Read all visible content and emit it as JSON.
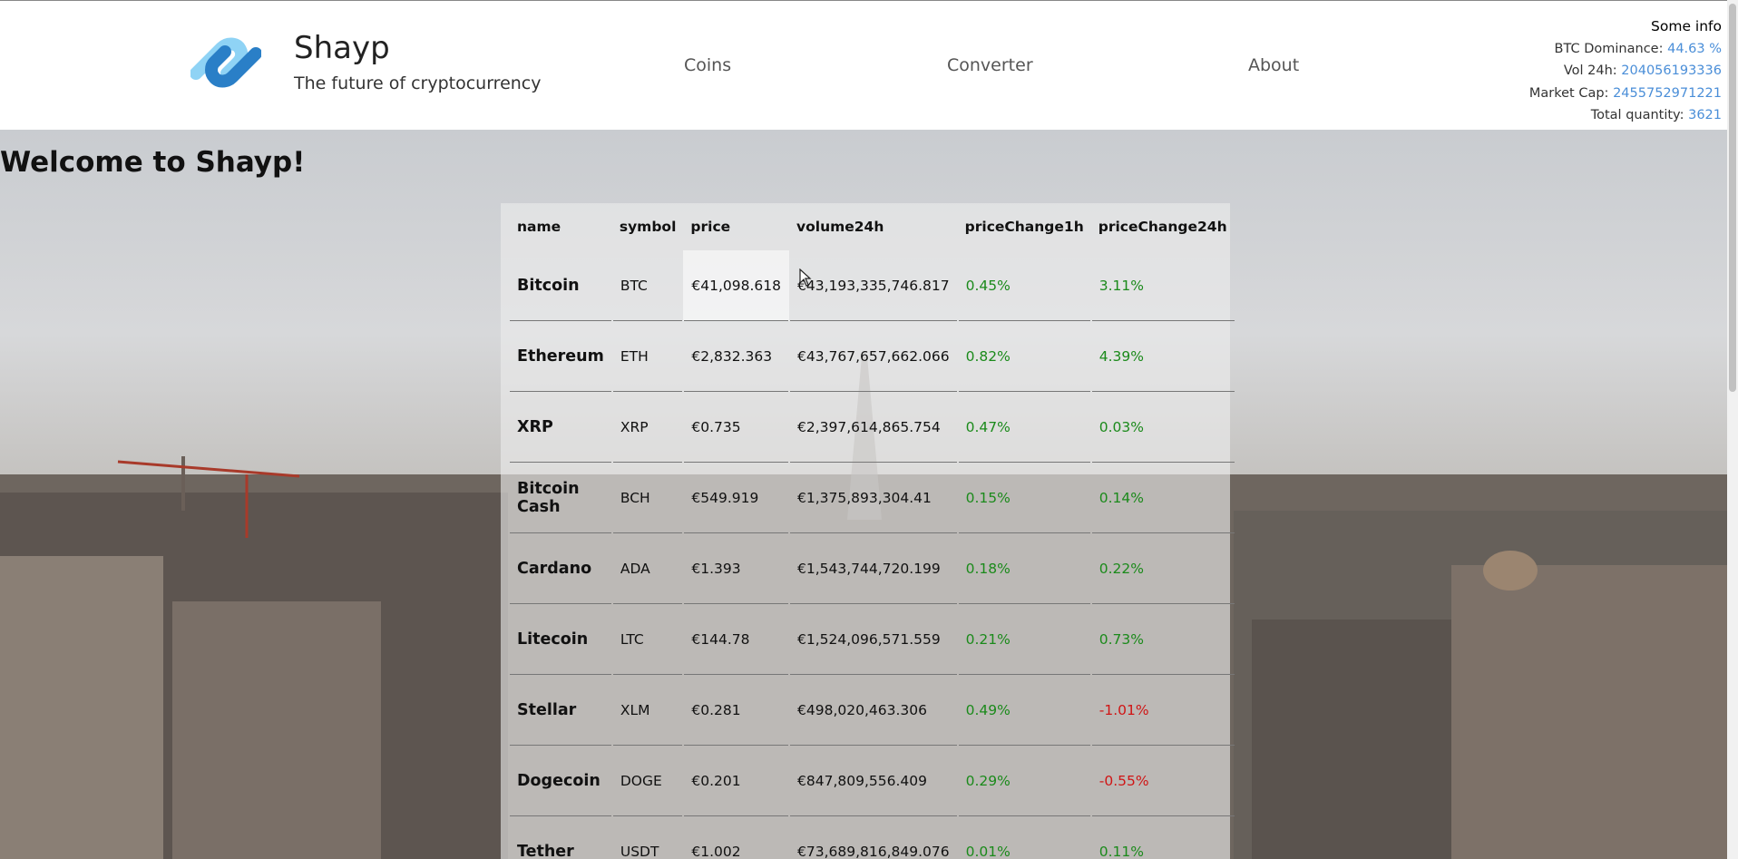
{
  "brand": {
    "name": "Shayp",
    "tagline": "The future of cryptocurrency",
    "logo_icon": "shayp-logo-icon",
    "colors": {
      "logo_light": "#8fd3f5",
      "logo_dark": "#2a7fc7"
    }
  },
  "nav": {
    "coins": "Coins",
    "converter": "Converter",
    "about": "About"
  },
  "info": {
    "title": "Some info",
    "btc_dominance_label": "BTC Dominance:",
    "btc_dominance_value": "44.63 %",
    "vol24h_label": "Vol 24h:",
    "vol24h_value": "204056193336",
    "market_cap_label": "Market Cap:",
    "market_cap_value": "2455752971221",
    "total_quantity_label": "Total quantity:",
    "total_quantity_value": "3621",
    "value_color": "#4a8ed8"
  },
  "main": {
    "welcome": "Welcome to Shayp!"
  },
  "table": {
    "headers": {
      "name": "name",
      "symbol": "symbol",
      "price": "price",
      "volume24h": "volume24h",
      "priceChange1h": "priceChange1h",
      "priceChange24h": "priceChange24h"
    },
    "rows": [
      {
        "name": "Bitcoin",
        "symbol": "BTC",
        "price": "€41,098.618",
        "volume24h": "€43,193,335,746.817",
        "priceChange1h": "0.45%",
        "priceChange24h": "3.11%"
      },
      {
        "name": "Ethereum",
        "symbol": "ETH",
        "price": "€2,832.363",
        "volume24h": "€43,767,657,662.066",
        "priceChange1h": "0.82%",
        "priceChange24h": "4.39%"
      },
      {
        "name": "XRP",
        "symbol": "XRP",
        "price": "€0.735",
        "volume24h": "€2,397,614,865.754",
        "priceChange1h": "0.47%",
        "priceChange24h": "0.03%"
      },
      {
        "name": "Bitcoin Cash",
        "symbol": "BCH",
        "price": "€549.919",
        "volume24h": "€1,375,893,304.41",
        "priceChange1h": "0.15%",
        "priceChange24h": "0.14%"
      },
      {
        "name": "Cardano",
        "symbol": "ADA",
        "price": "€1.393",
        "volume24h": "€1,543,744,720.199",
        "priceChange1h": "0.18%",
        "priceChange24h": "0.22%"
      },
      {
        "name": "Litecoin",
        "symbol": "LTC",
        "price": "€144.78",
        "volume24h": "€1,524,096,571.559",
        "priceChange1h": "0.21%",
        "priceChange24h": "0.73%"
      },
      {
        "name": "Stellar",
        "symbol": "XLM",
        "price": "€0.281",
        "volume24h": "€498,020,463.306",
        "priceChange1h": "0.49%",
        "priceChange24h": "-1.01%"
      },
      {
        "name": "Dogecoin",
        "symbol": "DOGE",
        "price": "€0.201",
        "volume24h": "€847,809,556.409",
        "priceChange1h": "0.29%",
        "priceChange24h": "-0.55%"
      },
      {
        "name": "Tether",
        "symbol": "USDT",
        "price": "€1.002",
        "volume24h": "€73,689,816,849.076",
        "priceChange1h": "0.01%",
        "priceChange24h": "0.11%"
      }
    ],
    "positive_color": "#1b8a1b",
    "negative_color": "#d01515"
  }
}
